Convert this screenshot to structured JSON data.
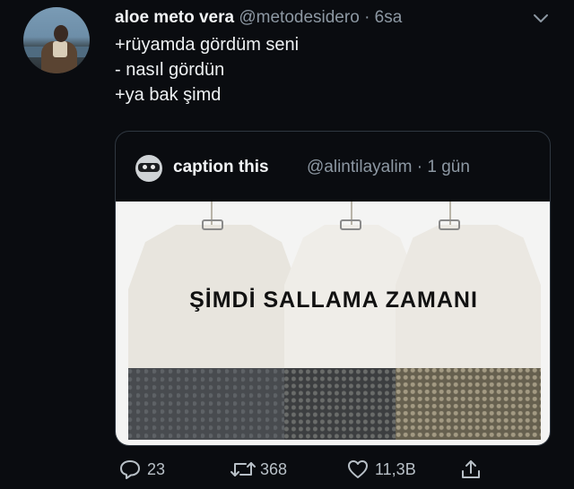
{
  "tweet": {
    "author_name": "aloe meto vera",
    "author_handle": "@metodesidero",
    "separator": "·",
    "time": "6sa",
    "lines": [
      "+rüyamda gördüm seni",
      "- nasıl gördün",
      "+ya bak şimd"
    ]
  },
  "quoted": {
    "author_name": "caption this",
    "author_handle": "@alintilayalim",
    "separator": "·",
    "time": "1 gün",
    "image_caption": "ŞİMDİ SALLAMA ZAMANI"
  },
  "actions": {
    "reply_count": "23",
    "retweet_count": "368",
    "like_count": "11,3B"
  },
  "icons": {
    "menu": "chevron-down-icon",
    "reply": "reply-icon",
    "retweet": "retweet-icon",
    "like": "heart-icon",
    "share": "share-icon"
  },
  "colors": {
    "background": "#0a0c10",
    "text_primary": "#eef1f3",
    "text_secondary": "#8d98a3",
    "border": "#2f3740"
  }
}
